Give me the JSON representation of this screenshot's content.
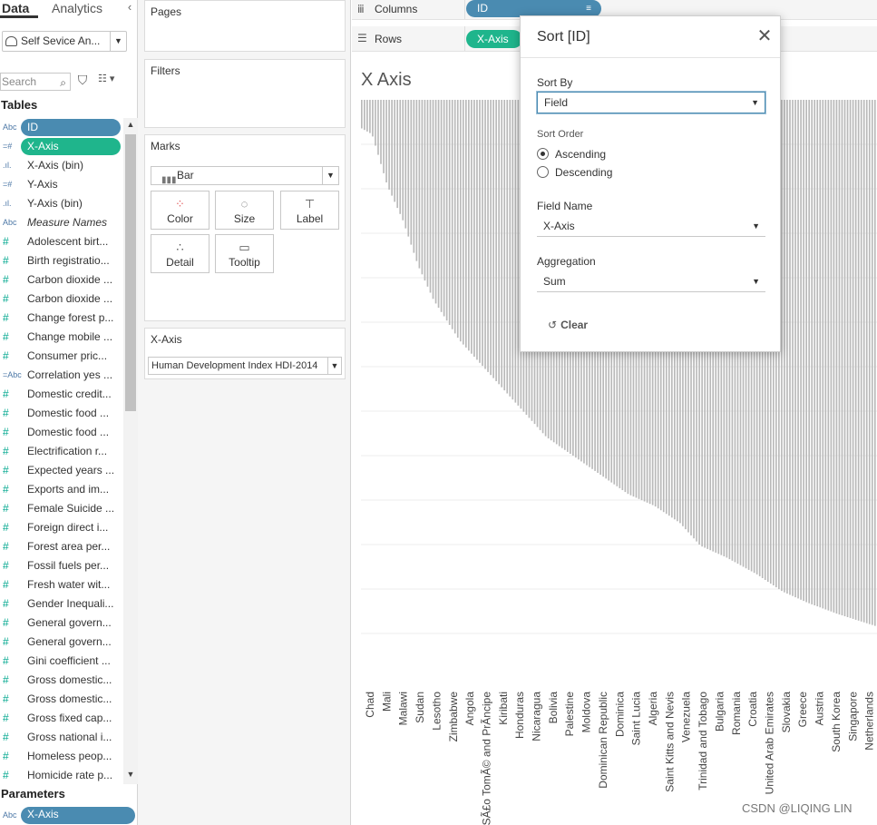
{
  "tabs": {
    "data": "Data",
    "analytics": "Analytics"
  },
  "icons": {
    "collapse": "chevron-left-icon",
    "datasource": "datasource-icon",
    "search": "search-icon",
    "filter": "funnel-icon",
    "view": "list-view-icon"
  },
  "datasource": {
    "name": "Self Sevice An..."
  },
  "search": {
    "placeholder": "Search"
  },
  "tables_heading": "Tables",
  "fields": [
    {
      "type_icon": "Abc",
      "label": "ID",
      "style": "pill-blue",
      "measure": false
    },
    {
      "type_icon": "=#",
      "label": "X-Axis",
      "style": "pill-green",
      "measure": false
    },
    {
      "type_icon": ".ıl.",
      "label": "X-Axis (bin)",
      "style": "",
      "measure": false
    },
    {
      "type_icon": "=#",
      "label": "Y-Axis",
      "style": "",
      "measure": false
    },
    {
      "type_icon": ".ıl.",
      "label": "Y-Axis (bin)",
      "style": "",
      "measure": false
    },
    {
      "type_icon": "Abc",
      "label": "Measure Names",
      "style": "italic",
      "measure": false
    },
    {
      "type_icon": "#",
      "label": "Adolescent birt...",
      "style": "",
      "measure": true
    },
    {
      "type_icon": "#",
      "label": "Birth registratio...",
      "style": "",
      "measure": true
    },
    {
      "type_icon": "#",
      "label": "Carbon dioxide ...",
      "style": "",
      "measure": true
    },
    {
      "type_icon": "#",
      "label": "Carbon dioxide ...",
      "style": "",
      "measure": true
    },
    {
      "type_icon": "#",
      "label": "Change forest p...",
      "style": "",
      "measure": true
    },
    {
      "type_icon": "#",
      "label": "Change mobile ...",
      "style": "",
      "measure": true
    },
    {
      "type_icon": "#",
      "label": "Consumer pric...",
      "style": "",
      "measure": true
    },
    {
      "type_icon": "=Abc",
      "label": "Correlation yes ...",
      "style": "",
      "measure": false
    },
    {
      "type_icon": "#",
      "label": "Domestic credit...",
      "style": "",
      "measure": true
    },
    {
      "type_icon": "#",
      "label": "Domestic food ...",
      "style": "",
      "measure": true
    },
    {
      "type_icon": "#",
      "label": "Domestic food ...",
      "style": "",
      "measure": true
    },
    {
      "type_icon": "#",
      "label": "Electrification r...",
      "style": "",
      "measure": true
    },
    {
      "type_icon": "#",
      "label": "Expected years ...",
      "style": "",
      "measure": true
    },
    {
      "type_icon": "#",
      "label": "Exports and im...",
      "style": "",
      "measure": true
    },
    {
      "type_icon": "#",
      "label": "Female Suicide ...",
      "style": "",
      "measure": true
    },
    {
      "type_icon": "#",
      "label": "Foreign direct i...",
      "style": "",
      "measure": true
    },
    {
      "type_icon": "#",
      "label": "Forest area per...",
      "style": "",
      "measure": true
    },
    {
      "type_icon": "#",
      "label": "Fossil fuels per...",
      "style": "",
      "measure": true
    },
    {
      "type_icon": "#",
      "label": "Fresh water wit...",
      "style": "",
      "measure": true
    },
    {
      "type_icon": "#",
      "label": "Gender Inequali...",
      "style": "",
      "measure": true
    },
    {
      "type_icon": "#",
      "label": "General govern...",
      "style": "",
      "measure": true
    },
    {
      "type_icon": "#",
      "label": "General govern...",
      "style": "",
      "measure": true
    },
    {
      "type_icon": "#",
      "label": "Gini coefficient ...",
      "style": "",
      "measure": true
    },
    {
      "type_icon": "#",
      "label": "Gross domestic...",
      "style": "",
      "measure": true
    },
    {
      "type_icon": "#",
      "label": "Gross domestic...",
      "style": "",
      "measure": true
    },
    {
      "type_icon": "#",
      "label": "Gross fixed cap...",
      "style": "",
      "measure": true
    },
    {
      "type_icon": "#",
      "label": "Gross national i...",
      "style": "",
      "measure": true
    },
    {
      "type_icon": "#",
      "label": "Homeless peop...",
      "style": "",
      "measure": true
    },
    {
      "type_icon": "#",
      "label": "Homicide rate p...",
      "style": "",
      "measure": true
    }
  ],
  "parameters_heading": "Parameters",
  "parameter": {
    "type_icon": "Abc",
    "label": "X-Axis"
  },
  "cards": {
    "pages": "Pages",
    "filters": "Filters",
    "marks": "Marks",
    "x_axis": "X-Axis"
  },
  "marks": {
    "type": "Bar",
    "buttons": [
      {
        "label": "Color",
        "icon": "color-icon",
        "glyph": "⁘"
      },
      {
        "label": "Size",
        "icon": "size-icon",
        "glyph": "◌"
      },
      {
        "label": "Label",
        "icon": "label-icon",
        "glyph": "T"
      },
      {
        "label": "Detail",
        "icon": "detail-icon",
        "glyph": "∴"
      },
      {
        "label": "Tooltip",
        "icon": "tooltip-icon",
        "glyph": "▭"
      }
    ]
  },
  "parameter_control": {
    "value": "Human Development Index HDI-2014"
  },
  "shelves": {
    "columns": {
      "label": "Columns",
      "icon": "columns-icon",
      "glyph": "iii"
    },
    "rows": {
      "label": "Rows",
      "icon": "rows-icon",
      "glyph": "☰"
    },
    "columns_pill": "ID",
    "rows_pill": "X-Axis",
    "sort_icon": "sort-ascending-icon"
  },
  "view": {
    "title": "X Axis"
  },
  "dialog": {
    "title": "Sort [ID]",
    "close_icon": "close-icon",
    "sort_by_label": "Sort By",
    "sort_by_value": "Field",
    "sort_order_label": "Sort Order",
    "ascending": "Ascending",
    "descending": "Descending",
    "selected_order": "ascending",
    "field_name_label": "Field Name",
    "field_name_value": "X-Axis",
    "aggregation_label": "Aggregation",
    "aggregation_value": "Sum",
    "clear_label": "Clear",
    "clear_icon": "undo-icon"
  },
  "chart_data": {
    "type": "bar",
    "orientation": "vertical",
    "order": "ascending",
    "bar_count": 188,
    "value_scale": [
      0,
      1
    ],
    "grid": true,
    "bar_color": "#b9b9b9",
    "categories": [
      "Chad",
      "Mali",
      "Malawi",
      "Sudan",
      "Lesotho",
      "Zimbabwe",
      "Angola",
      "SÃ£o TomÃ© and PrÃ­ncipe",
      "Kiribati",
      "Honduras",
      "Nicaragua",
      "Bolivia",
      "Palestine",
      "Moldova",
      "Dominican Republic",
      "Dominica",
      "Saint Lucia",
      "Algeria",
      "Saint Kitts and Nevis",
      "Venezuela",
      "Trinidad and Tobago",
      "Bulgaria",
      "Romania",
      "Croatia",
      "United Arab Emirates",
      "Slovakia",
      "Greece",
      "Austria",
      "South Korea",
      "Singapore",
      "Netherlands"
    ],
    "categories_display": [
      "Chad",
      "Mali",
      "Malawi",
      "Sudan",
      "Lesotho",
      "Zimbabwe",
      "Angola",
      "SÃ£o TomÃ© and PrÃ­ncipe",
      "Kiribati",
      "Honduras",
      "Nicaragua",
      "Bolivia",
      "Palestine",
      "Moldova",
      "Dominican Republic",
      "Dominica",
      "Saint Lucia",
      "Algeria",
      "Saint Kitts and Nevis",
      "Venezuela",
      "Trinidad and Tobago",
      "Bulgaria",
      "Romania",
      "Croatia",
      "United Arab Emirates",
      "Slovakia",
      "Greece",
      "Austria",
      "South Korea",
      "Singapore",
      "Netherlands"
    ],
    "profile": [
      [
        0,
        0.05
      ],
      [
        0.02,
        0.06
      ],
      [
        0.05,
        0.15
      ],
      [
        0.08,
        0.21
      ],
      [
        0.11,
        0.29
      ],
      [
        0.14,
        0.35
      ],
      [
        0.19,
        0.42
      ],
      [
        0.25,
        0.48
      ],
      [
        0.31,
        0.54
      ],
      [
        0.36,
        0.59
      ],
      [
        0.44,
        0.64
      ],
      [
        0.52,
        0.69
      ],
      [
        0.57,
        0.71
      ],
      [
        0.62,
        0.74
      ],
      [
        0.66,
        0.78
      ],
      [
        0.71,
        0.8
      ],
      [
        0.77,
        0.83
      ],
      [
        0.82,
        0.86
      ],
      [
        0.87,
        0.88
      ],
      [
        0.93,
        0.9
      ],
      [
        1,
        0.92
      ]
    ]
  },
  "watermark": "CSDN @LIQING LIN"
}
